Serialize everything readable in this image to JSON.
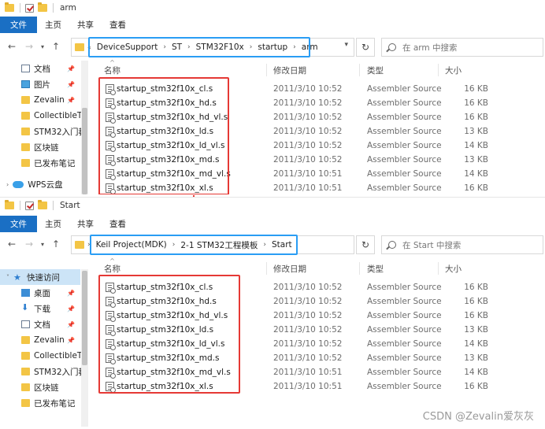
{
  "window1": {
    "title": "arm",
    "ribbon_tabs": [
      "文件",
      "主页",
      "共享",
      "查看"
    ],
    "breadcrumb": [
      "DeviceSupport",
      "ST",
      "STM32F10x",
      "startup",
      "arm"
    ],
    "search_placeholder": "在 arm 中搜索",
    "columns": {
      "name": "名称",
      "date": "修改日期",
      "type": "类型",
      "size": "大小"
    },
    "sidebar": [
      {
        "label": "文档",
        "icon": "document-icon",
        "pinned": true
      },
      {
        "label": "图片",
        "icon": "picture-icon",
        "pinned": true
      },
      {
        "label": "Zevalin",
        "icon": "folder-icon",
        "pinned": true
      },
      {
        "label": "CollectibleT",
        "icon": "folder-icon",
        "pinned": false
      },
      {
        "label": "STM32入门教",
        "icon": "folder-icon",
        "pinned": false
      },
      {
        "label": "区块链",
        "icon": "folder-icon",
        "pinned": false
      },
      {
        "label": "已发布笔记",
        "icon": "folder-icon",
        "pinned": false
      },
      {
        "label": "WPS云盘",
        "icon": "cloud-icon",
        "pinned": false
      }
    ],
    "files": [
      {
        "name": "startup_stm32f10x_cl.s",
        "date": "2011/3/10 10:52",
        "type": "Assembler Source",
        "size": "16 KB"
      },
      {
        "name": "startup_stm32f10x_hd.s",
        "date": "2011/3/10 10:52",
        "type": "Assembler Source",
        "size": "16 KB"
      },
      {
        "name": "startup_stm32f10x_hd_vl.s",
        "date": "2011/3/10 10:52",
        "type": "Assembler Source",
        "size": "16 KB"
      },
      {
        "name": "startup_stm32f10x_ld.s",
        "date": "2011/3/10 10:52",
        "type": "Assembler Source",
        "size": "13 KB"
      },
      {
        "name": "startup_stm32f10x_ld_vl.s",
        "date": "2011/3/10 10:52",
        "type": "Assembler Source",
        "size": "14 KB"
      },
      {
        "name": "startup_stm32f10x_md.s",
        "date": "2011/3/10 10:52",
        "type": "Assembler Source",
        "size": "13 KB"
      },
      {
        "name": "startup_stm32f10x_md_vl.s",
        "date": "2011/3/10 10:51",
        "type": "Assembler Source",
        "size": "14 KB"
      },
      {
        "name": "startup_stm32f10x_xl.s",
        "date": "2011/3/10 10:51",
        "type": "Assembler Source",
        "size": "16 KB"
      }
    ]
  },
  "window2": {
    "title": "Start",
    "ribbon_tabs": [
      "文件",
      "主页",
      "共享",
      "查看"
    ],
    "breadcrumb": [
      "Keil Project(MDK)",
      "2-1 STM32工程模板",
      "Start"
    ],
    "search_placeholder": "在 Start 中搜索",
    "columns": {
      "name": "名称",
      "date": "修改日期",
      "type": "类型",
      "size": "大小"
    },
    "sidebar": [
      {
        "label": "快速访问",
        "icon": "star-icon",
        "pinned": false,
        "selected": true
      },
      {
        "label": "桌面",
        "icon": "desktop-icon",
        "pinned": true
      },
      {
        "label": "下载",
        "icon": "download-icon",
        "pinned": true
      },
      {
        "label": "文档",
        "icon": "document-icon",
        "pinned": true
      },
      {
        "label": "Zevalin",
        "icon": "folder-icon",
        "pinned": true
      },
      {
        "label": "CollectibleT",
        "icon": "folder-icon",
        "pinned": false
      },
      {
        "label": "STM32入门教",
        "icon": "folder-icon",
        "pinned": false
      },
      {
        "label": "区块链",
        "icon": "folder-icon",
        "pinned": false
      },
      {
        "label": "已发布笔记",
        "icon": "folder-icon",
        "pinned": false
      }
    ],
    "files": [
      {
        "name": "startup_stm32f10x_cl.s",
        "date": "2011/3/10 10:52",
        "type": "Assembler Source",
        "size": "16 KB"
      },
      {
        "name": "startup_stm32f10x_hd.s",
        "date": "2011/3/10 10:52",
        "type": "Assembler Source",
        "size": "16 KB"
      },
      {
        "name": "startup_stm32f10x_hd_vl.s",
        "date": "2011/3/10 10:52",
        "type": "Assembler Source",
        "size": "16 KB"
      },
      {
        "name": "startup_stm32f10x_ld.s",
        "date": "2011/3/10 10:52",
        "type": "Assembler Source",
        "size": "13 KB"
      },
      {
        "name": "startup_stm32f10x_ld_vl.s",
        "date": "2011/3/10 10:52",
        "type": "Assembler Source",
        "size": "14 KB"
      },
      {
        "name": "startup_stm32f10x_md.s",
        "date": "2011/3/10 10:52",
        "type": "Assembler Source",
        "size": "13 KB"
      },
      {
        "name": "startup_stm32f10x_md_vl.s",
        "date": "2011/3/10 10:51",
        "type": "Assembler Source",
        "size": "14 KB"
      },
      {
        "name": "startup_stm32f10x_xl.s",
        "date": "2011/3/10 10:51",
        "type": "Assembler Source",
        "size": "16 KB"
      }
    ]
  },
  "watermark": "CSDN @Zevalin爱灰灰",
  "colors": {
    "accent": "#1a6fc4",
    "highlight_red": "#e53935",
    "highlight_blue": "#2a9df4",
    "folder": "#f3c545"
  }
}
